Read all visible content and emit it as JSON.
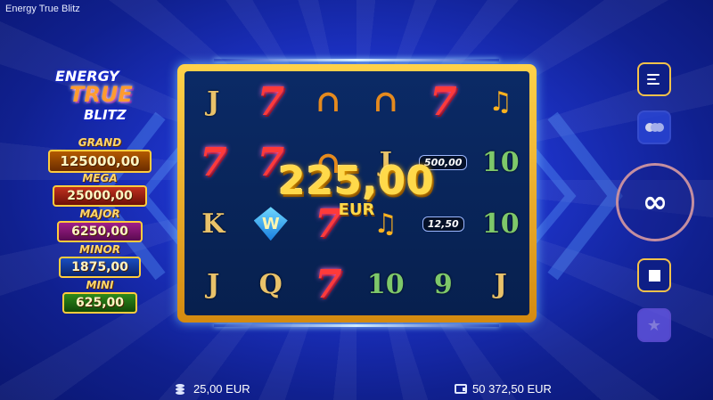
{
  "app": {
    "title": "Energy True Blitz"
  },
  "logo": {
    "line1": "ENERGY",
    "line2": "TRUE",
    "line3": "BLITZ"
  },
  "jackpots": [
    {
      "name": "GRAND",
      "value": "125000,00"
    },
    {
      "name": "MEGA",
      "value": "25000,00"
    },
    {
      "name": "MAJOR",
      "value": "6250,00"
    },
    {
      "name": "MINOR",
      "value": "1875,00"
    },
    {
      "name": "MINI",
      "value": "625,00"
    }
  ],
  "reels": {
    "rows": [
      [
        "J",
        "7",
        "H",
        "H",
        "7",
        "B"
      ],
      [
        "7",
        "7",
        "H",
        "J",
        "C",
        "10"
      ],
      [
        "K",
        "W",
        "7",
        "B",
        "C",
        "10"
      ],
      [
        "J",
        "Q",
        "7",
        "10",
        "9",
        "J"
      ]
    ],
    "coin_values": {
      "r1c4": "500,00",
      "r2c4": "12,50"
    }
  },
  "win": {
    "amount": "225,00",
    "currency": "EUR"
  },
  "controls": {
    "spin_symbol": "∞",
    "menu_icon": "menu-icon",
    "toggle_icon": "autoplay-toggle-icon",
    "stop_icon": "stop-icon",
    "fav_icon": "star-icon"
  },
  "footer": {
    "bet": "25,00 EUR",
    "balance": "50 372,50 EUR"
  }
}
